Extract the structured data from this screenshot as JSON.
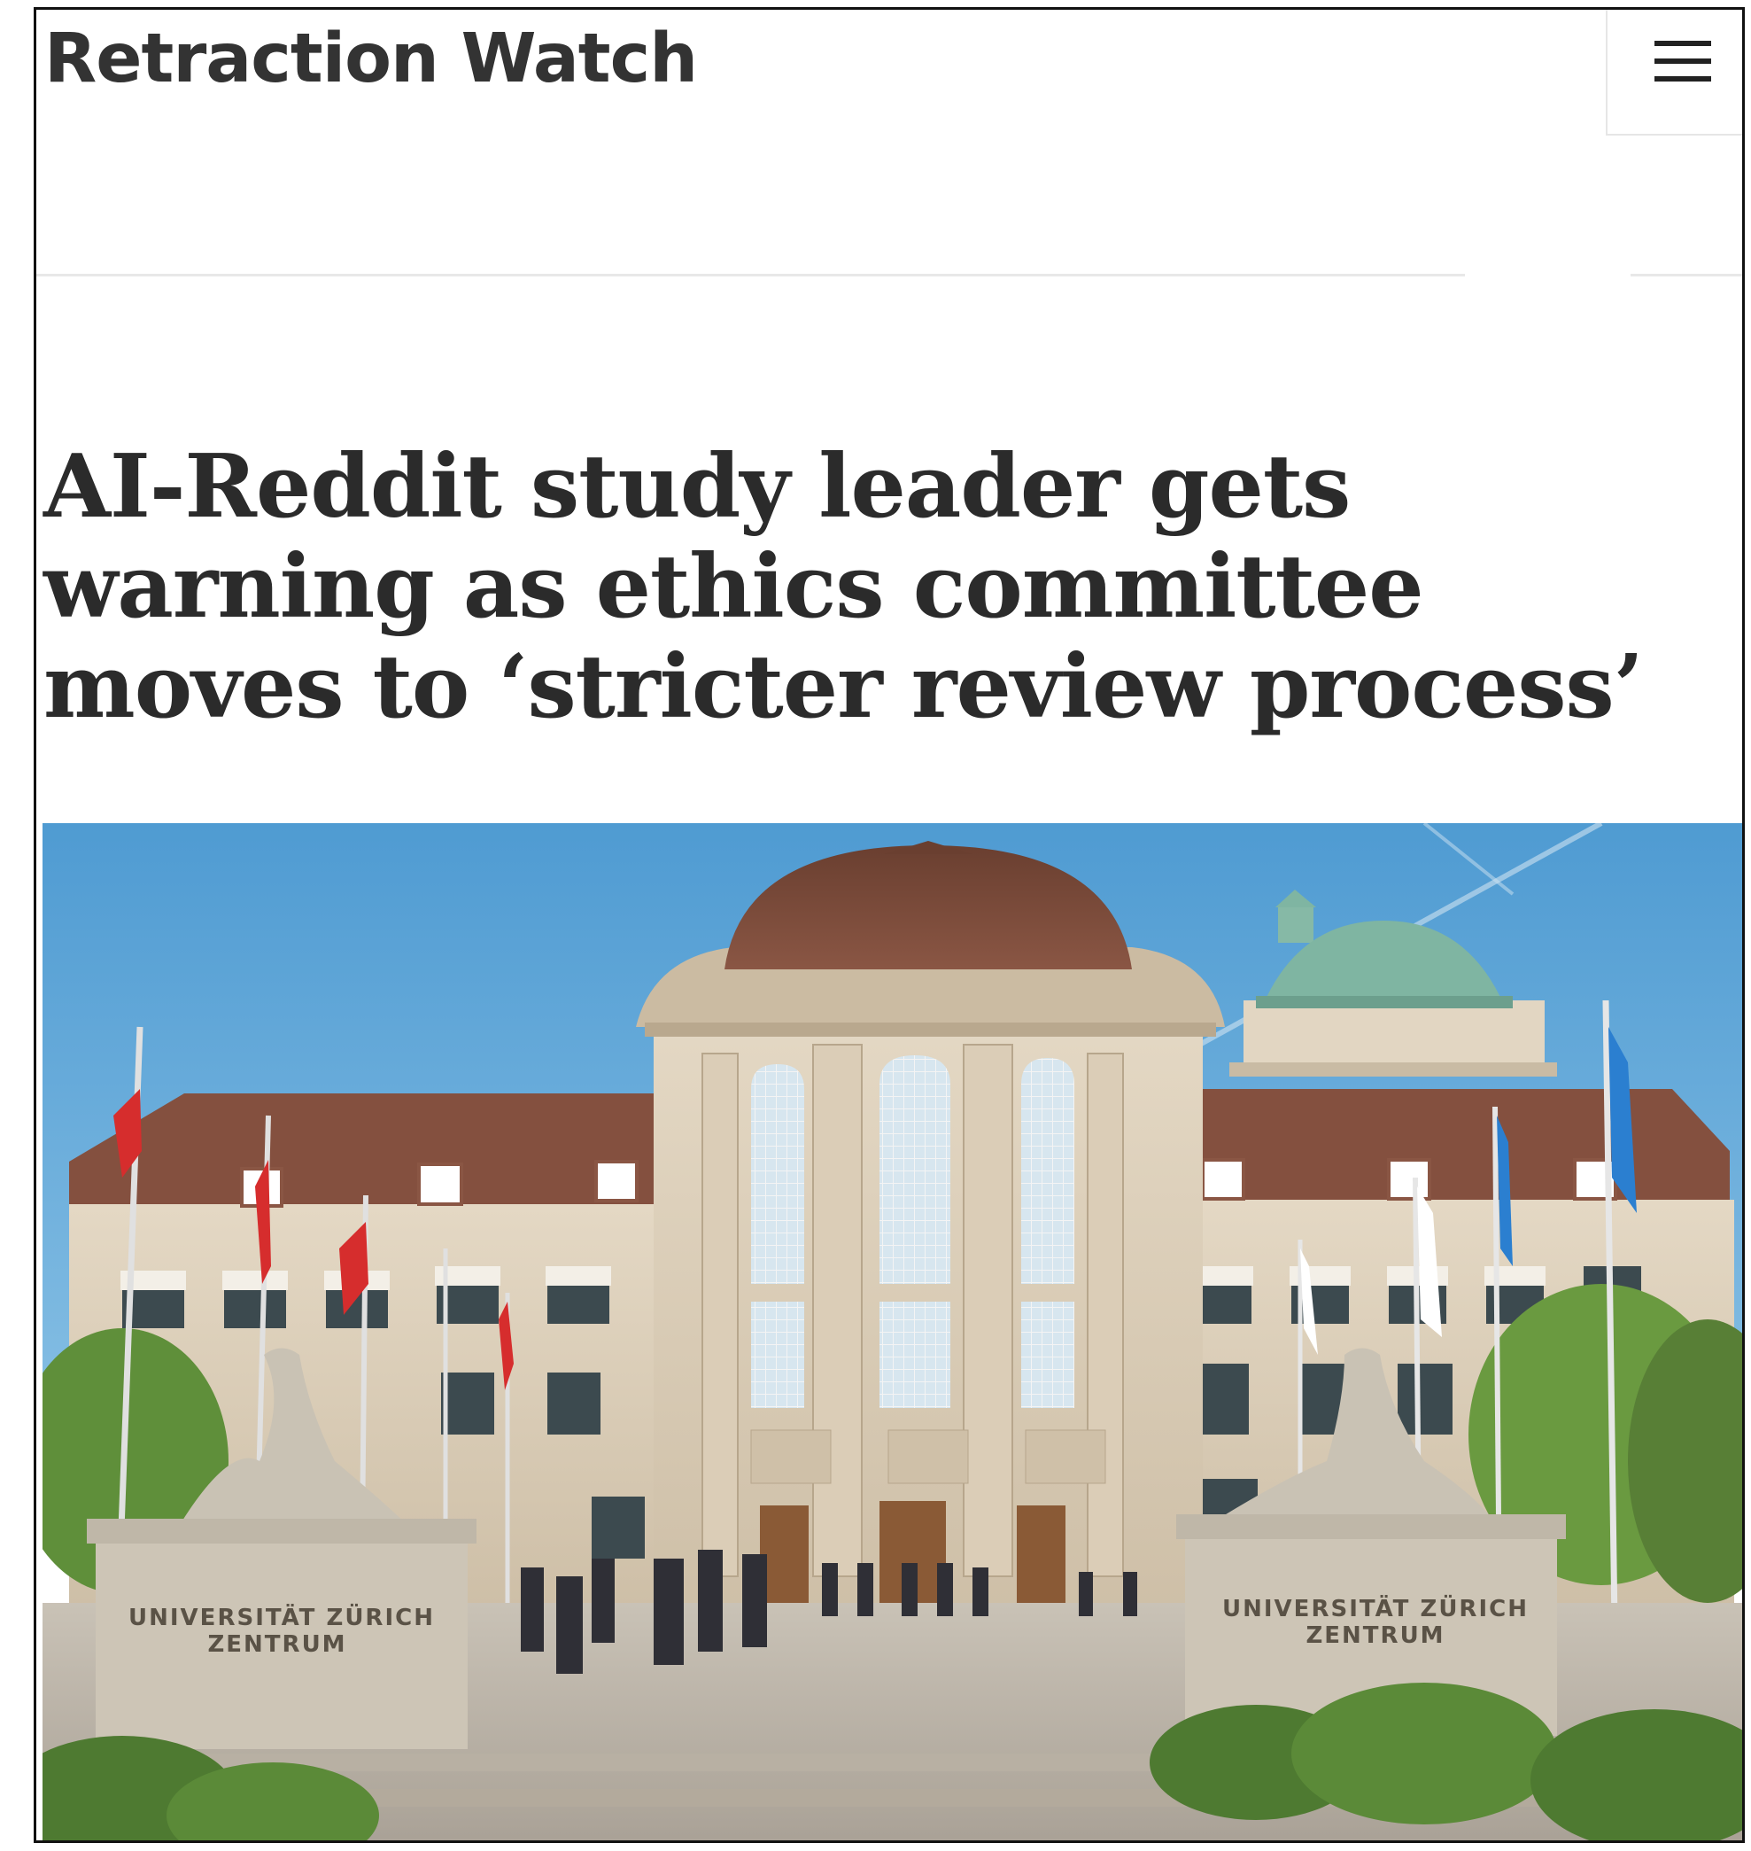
{
  "site": {
    "title": "Retraction Watch"
  },
  "menu": {
    "icon": "hamburger-menu-icon"
  },
  "article": {
    "headline": "AI-Reddit study leader gets warning as ethics committee moves to ‘stricter review process’"
  },
  "image": {
    "plinth_left_line1": "UNIVERSITÄT ZÜRICH",
    "plinth_left_line2": "ZENTRUM",
    "plinth_right_line1": "UNIVERSITÄT ZÜRICH",
    "plinth_right_line2": "ZENTRUM"
  },
  "colors": {
    "title_text": "#333333",
    "headline_text": "#2b2b2b",
    "sky": "#5fa7d8",
    "roof": "#7a4a3a",
    "dome_copper": "#7fb5a2",
    "stone": "#d8cbb6",
    "flag_red": "#d62d2d"
  }
}
